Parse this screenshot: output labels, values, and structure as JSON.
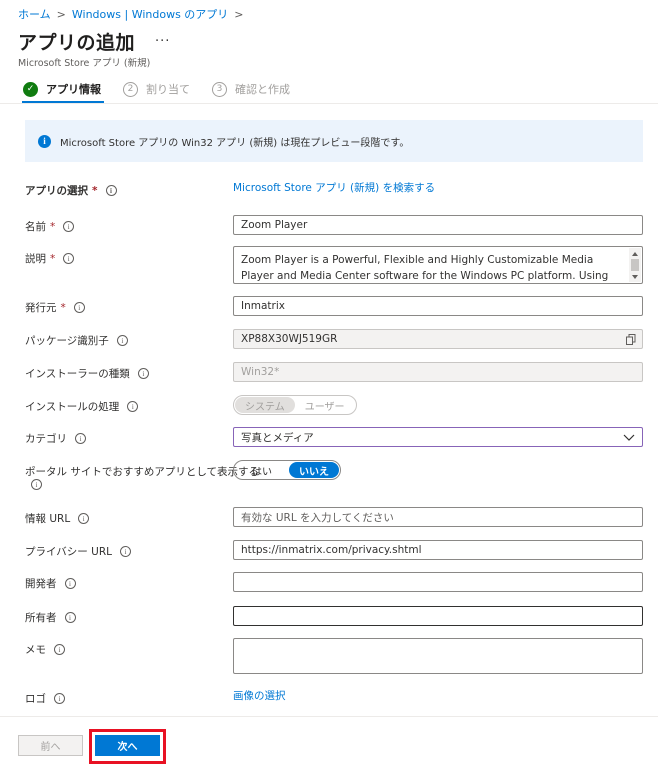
{
  "breadcrumb": {
    "home": "ホーム",
    "sep": ">",
    "page": "Windows | Windows のアプリ"
  },
  "header": {
    "title": "アプリの追加",
    "more": "···",
    "subtitle": "Microsoft Store アプリ (新規)"
  },
  "steps": [
    {
      "number": "✓",
      "label": "アプリ情報",
      "state": "completed-active"
    },
    {
      "number": "2",
      "label": "割り当て",
      "state": "pending"
    },
    {
      "number": "3",
      "label": "確認と作成",
      "state": "pending"
    }
  ],
  "info_banner": {
    "icon": "info-icon",
    "text": "Microsoft Store アプリの Win32 アプリ (新規) は現在プレビュー段階です。"
  },
  "form": {
    "app_select": {
      "label": "アプリの選択",
      "required": "*",
      "link": "Microsoft Store アプリ (新規) を検索する"
    },
    "name": {
      "label": "名前",
      "required": "*",
      "value": "Zoom Player"
    },
    "description": {
      "label": "説明",
      "required": "*",
      "value": "Zoom Player is a Powerful, Flexible and Highly Customizable Media Player and Media Center software for the Windows PC platform. Using our Smart Play"
    },
    "publisher": {
      "label": "発行元",
      "required": "*",
      "value": "Inmatrix"
    },
    "package_id": {
      "label": "パッケージ識別子",
      "value": "XP88X30WJ519GR"
    },
    "installer_type": {
      "label": "インストーラーの種類",
      "value": "Win32*"
    },
    "install_behavior": {
      "label": "インストールの処理",
      "options": [
        "システム",
        "ユーザー"
      ],
      "selected": "システム"
    },
    "category": {
      "label": "カテゴリ",
      "value": "写真とメディア"
    },
    "featured": {
      "label": "ポータル サイトでおすすめアプリとして表示する",
      "options": [
        "はい",
        "いいえ"
      ],
      "selected": "いいえ"
    },
    "info_url": {
      "label": "情報 URL",
      "placeholder": "有効な URL を入力してください",
      "value": ""
    },
    "privacy_url": {
      "label": "プライバシー URL",
      "value": "https://inmatrix.com/privacy.shtml"
    },
    "developer": {
      "label": "開発者",
      "value": ""
    },
    "owner": {
      "label": "所有者",
      "value": ""
    },
    "notes": {
      "label": "メモ",
      "value": ""
    },
    "logo": {
      "label": "ロゴ",
      "link": "画像の選択"
    }
  },
  "footer": {
    "prev": "前へ",
    "next": "次へ"
  },
  "colors": {
    "accent": "#0078d4",
    "success": "#107c10",
    "highlight": "#e81123",
    "required": "#a4262c"
  }
}
